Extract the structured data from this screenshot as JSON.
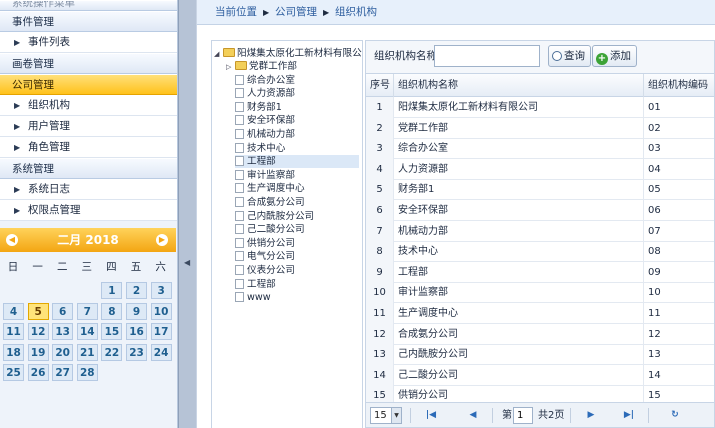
{
  "sidebar": {
    "top_cut_label": "系统操作菜单",
    "groups": [
      {
        "title": "事件管理",
        "items": [
          "事件列表"
        ]
      },
      {
        "title": "画卷管理",
        "items": []
      },
      {
        "title": "公司管理",
        "items": [
          "组织机构",
          "用户管理",
          "角色管理"
        ],
        "active": true
      },
      {
        "title": "系统管理",
        "items": [
          "系统日志",
          "权限点管理"
        ]
      }
    ]
  },
  "calendar": {
    "title": "二月 2018",
    "prev_icon": "prev-month-icon",
    "next_icon": "next-month-icon",
    "weekdays": [
      "日",
      "一",
      "二",
      "三",
      "四",
      "五",
      "六"
    ],
    "weeks": [
      [
        "",
        "",
        "",
        "",
        "1",
        "2",
        "3"
      ],
      [
        "4",
        "5",
        "6",
        "7",
        "8",
        "9",
        "10"
      ],
      [
        "11",
        "12",
        "13",
        "14",
        "15",
        "16",
        "17"
      ],
      [
        "18",
        "19",
        "20",
        "21",
        "22",
        "23",
        "24"
      ],
      [
        "25",
        "26",
        "27",
        "28",
        "",
        "",
        ""
      ]
    ],
    "today": "5",
    "colors": {
      "header": "#f3a512",
      "today": "#ffe37a"
    }
  },
  "breadcrumb": {
    "items": [
      "当前位置",
      "公司管理",
      "组织机构"
    ]
  },
  "tree": {
    "root": "阳煤集太原化工新材料有限公司",
    "children": [
      {
        "label": "党群工作部",
        "folder": true
      },
      {
        "label": "综合办公室"
      },
      {
        "label": "人力资源部"
      },
      {
        "label": "财务部1"
      },
      {
        "label": "安全环保部"
      },
      {
        "label": "机械动力部"
      },
      {
        "label": "技术中心"
      },
      {
        "label": "工程部",
        "selected": true
      },
      {
        "label": "审计监察部"
      },
      {
        "label": "生产调度中心"
      },
      {
        "label": "合成氨分公司"
      },
      {
        "label": "己内酰胺分公司"
      },
      {
        "label": "己二酸分公司"
      },
      {
        "label": "供销分公司"
      },
      {
        "label": "电气分公司"
      },
      {
        "label": "仪表分公司"
      },
      {
        "label": "工程部"
      },
      {
        "label": "www"
      }
    ]
  },
  "search": {
    "label": "组织机构名称:",
    "value": "",
    "placeholder": "",
    "query_label": "查询",
    "add_label": "添加"
  },
  "grid": {
    "columns": [
      "序号",
      "组织机构名称",
      "组织机构编码"
    ],
    "rows": [
      [
        "1",
        "阳煤集太原化工新材料有限公司",
        "01"
      ],
      [
        "2",
        "党群工作部",
        "02"
      ],
      [
        "3",
        "综合办公室",
        "03"
      ],
      [
        "4",
        "人力资源部",
        "04"
      ],
      [
        "5",
        "财务部1",
        "05"
      ],
      [
        "6",
        "安全环保部",
        "06"
      ],
      [
        "7",
        "机械动力部",
        "07"
      ],
      [
        "8",
        "技术中心",
        "08"
      ],
      [
        "9",
        "工程部",
        "09"
      ],
      [
        "10",
        "审计监察部",
        "10"
      ],
      [
        "11",
        "生产调度中心",
        "11"
      ],
      [
        "12",
        "合成氨分公司",
        "12"
      ],
      [
        "13",
        "己内酰胺分公司",
        "13"
      ],
      [
        "14",
        "己二酸分公司",
        "14"
      ],
      [
        "15",
        "供销分公司",
        "15"
      ]
    ]
  },
  "pager": {
    "page_size": "15",
    "page_prefix": "第",
    "page_value": "1",
    "page_suffix": "共2页"
  }
}
